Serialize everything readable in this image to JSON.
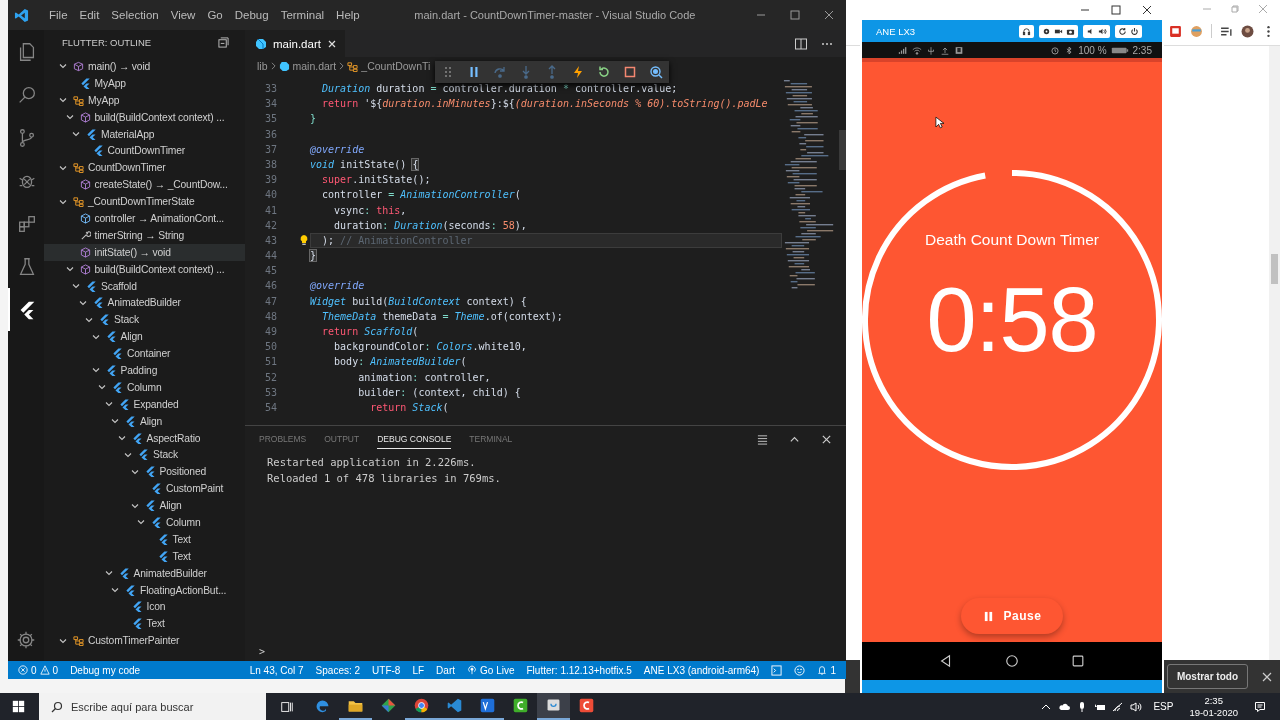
{
  "vscode": {
    "menu": [
      "File",
      "Edit",
      "Selection",
      "View",
      "Go",
      "Debug",
      "Terminal",
      "Help"
    ],
    "title": "main.dart - CountDownTimer-master - Visual Studio Code",
    "activity": [
      {
        "kind": "files",
        "selected": false
      },
      {
        "kind": "search",
        "selected": false
      },
      {
        "kind": "scm",
        "selected": false
      },
      {
        "kind": "debug",
        "selected": false
      },
      {
        "kind": "extensions",
        "selected": false
      },
      {
        "kind": "test",
        "selected": false
      },
      {
        "kind": "flutter",
        "selected": true
      }
    ],
    "sidebar": {
      "title": "FLUTTER: OUTLINE",
      "outline": [
        {
          "label": "main() → void",
          "kind": "function",
          "expanded": true,
          "selected": false,
          "children": [
            {
              "label": "MyApp",
              "kind": "widget",
              "selected": false
            }
          ]
        },
        {
          "label": "MyApp",
          "kind": "class",
          "expanded": true,
          "selected": false,
          "children": [
            {
              "label": "build(BuildContext context) ...",
              "kind": "method",
              "expanded": true,
              "selected": false,
              "children": [
                {
                  "label": "MaterialApp",
                  "kind": "widget",
                  "expanded": true,
                  "selected": false,
                  "children": [
                    {
                      "label": "CountDownTimer",
                      "kind": "widget",
                      "selected": false
                    }
                  ]
                }
              ]
            }
          ]
        },
        {
          "label": "CountDownTimer",
          "kind": "class",
          "expanded": true,
          "selected": false,
          "children": [
            {
              "label": "createState() → _CountDow...",
              "kind": "method",
              "selected": false
            }
          ]
        },
        {
          "label": "_CountDownTimerState",
          "kind": "class",
          "expanded": true,
          "selected": false,
          "children": [
            {
              "label": "controller → AnimationCont...",
              "kind": "field",
              "selected": false
            },
            {
              "label": "timerString → String",
              "kind": "getter",
              "selected": false
            },
            {
              "label": "initState() → void",
              "kind": "method",
              "selected": true
            },
            {
              "label": "build(BuildContext context) ...",
              "kind": "method",
              "expanded": true,
              "selected": false,
              "children": [
                {
                  "label": "Scaffold",
                  "kind": "widget",
                  "expanded": true,
                  "selected": false,
                  "children": [
                    {
                      "label": "AnimatedBuilder",
                      "kind": "widget",
                      "expanded": true,
                      "selected": false,
                      "children": [
                        {
                          "label": "Stack",
                          "kind": "widget",
                          "expanded": true,
                          "selected": false,
                          "children": [
                            {
                              "label": "Align",
                              "kind": "widget",
                              "expanded": true,
                              "selected": false,
                              "children": [
                                {
                                  "label": "Container",
                                  "kind": "widget",
                                  "selected": false
                                }
                              ]
                            },
                            {
                              "label": "Padding",
                              "kind": "widget",
                              "expanded": true,
                              "selected": false,
                              "children": [
                                {
                                  "label": "Column",
                                  "kind": "widget",
                                  "expanded": true,
                                  "selected": false,
                                  "children": [
                                    {
                                      "label": "Expanded",
                                      "kind": "widget",
                                      "expanded": true,
                                      "selected": false,
                                      "children": [
                                        {
                                          "label": "Align",
                                          "kind": "widget",
                                          "expanded": true,
                                          "selected": false,
                                          "children": [
                                            {
                                              "label": "AspectRatio",
                                              "kind": "widget",
                                              "expanded": true,
                                              "selected": false,
                                              "children": [
                                                {
                                                  "label": "Stack",
                                                  "kind": "widget",
                                                  "expanded": true,
                                                  "selected": false,
                                                  "children": [
                                                    {
                                                      "label": "Positioned",
                                                      "kind": "widget",
                                                      "expanded": true,
                                                      "selected": false,
                                                      "children": [
                                                        {
                                                          "label": "CustomPaint",
                                                          "kind": "widget",
                                                          "selected": false
                                                        }
                                                      ]
                                                    },
                                                    {
                                                      "label": "Align",
                                                      "kind": "widget",
                                                      "expanded": true,
                                                      "selected": false,
                                                      "children": [
                                                        {
                                                          "label": "Column",
                                                          "kind": "widget",
                                                          "expanded": true,
                                                          "selected": false,
                                                          "children": [
                                                            {
                                                              "label": "Text",
                                                              "kind": "widget",
                                                              "selected": false
                                                            },
                                                            {
                                                              "label": "Text",
                                                              "kind": "widget",
                                                              "selected": false
                                                            }
                                                          ]
                                                        }
                                                      ]
                                                    }
                                                  ]
                                                }
                                              ]
                                            }
                                          ]
                                        }
                                      ]
                                    },
                                    {
                                      "label": "AnimatedBuilder",
                                      "kind": "widget",
                                      "expanded": true,
                                      "selected": false,
                                      "children": [
                                        {
                                          "label": "FloatingActionBut...",
                                          "kind": "widget",
                                          "expanded": true,
                                          "selected": false,
                                          "children": [
                                            {
                                              "label": "Icon",
                                              "kind": "widget",
                                              "selected": false
                                            },
                                            {
                                              "label": "Text",
                                              "kind": "widget",
                                              "selected": false
                                            }
                                          ]
                                        }
                                      ]
                                    }
                                  ]
                                }
                              ]
                            }
                          ]
                        }
                      ]
                    }
                  ]
                }
              ]
            }
          ]
        },
        {
          "label": "CustomTimerPainter",
          "kind": "class",
          "expanded": true,
          "selected": false
        }
      ]
    },
    "tab": {
      "label": "main.dart"
    },
    "breadcrumb": [
      "lib",
      "main.dart",
      "_CountDownTi"
    ],
    "code": [
      {
        "number": "33",
        "current": false,
        "tokens": [
          {
            "kind": "type",
            "text": "  Duration"
          },
          {
            "kind": "p",
            "text": " duration "
          },
          {
            "kind": "punc",
            "text": "="
          },
          {
            "kind": "p",
            "text": " controller.duration "
          },
          {
            "kind": "punc",
            "text": "*"
          },
          {
            "kind": "p",
            "text": " controller.value;"
          }
        ]
      },
      {
        "number": "34",
        "current": false,
        "tokens": [
          {
            "kind": "kw",
            "text": "  return"
          },
          {
            "kind": "p",
            "text": " '${"
          },
          {
            "kind": "str",
            "text": "duration.inMinutes"
          },
          {
            "kind": "p",
            "text": "}:${"
          },
          {
            "kind": "str",
            "text": "(duration.inSeconds % 60).toString().padLe"
          }
        ]
      },
      {
        "number": "35",
        "current": false,
        "tokens": [
          {
            "kind": "punc",
            "text": "}"
          }
        ]
      },
      {
        "number": "36",
        "current": false
      },
      {
        "number": "37",
        "current": false,
        "tokens": [
          {
            "kind": "deco",
            "text": "@override"
          }
        ]
      },
      {
        "number": "38",
        "current": false,
        "tokens": [
          {
            "kind": "type",
            "text": "void"
          },
          {
            "kind": "p",
            "text": " initState() "
          },
          {
            "kind": "match",
            "text": "{"
          }
        ]
      },
      {
        "number": "39",
        "current": false,
        "tokens": [
          {
            "kind": "kw",
            "text": "  super"
          },
          {
            "kind": "p",
            "text": ".initState();"
          }
        ]
      },
      {
        "number": "40",
        "current": false,
        "tokens": [
          {
            "kind": "p",
            "text": "  controller "
          },
          {
            "kind": "punc",
            "text": "="
          },
          {
            "kind": "type",
            "text": " AnimationController"
          },
          {
            "kind": "p",
            "text": "("
          }
        ]
      },
      {
        "number": "41",
        "current": false,
        "tokens": [
          {
            "kind": "p",
            "text": "    vsync"
          },
          {
            "kind": "punc",
            "text": ":"
          },
          {
            "kind": "kw",
            "text": " this"
          },
          {
            "kind": "p",
            "text": ","
          }
        ]
      },
      {
        "number": "42",
        "current": false,
        "tokens": [
          {
            "kind": "p",
            "text": "    duration"
          },
          {
            "kind": "punc",
            "text": ":"
          },
          {
            "kind": "type",
            "text": " Duration"
          },
          {
            "kind": "p",
            "text": "(seconds"
          },
          {
            "kind": "punc",
            "text": ":"
          },
          {
            "kind": "num",
            "text": " 58"
          },
          {
            "kind": "p",
            "text": "),"
          }
        ]
      },
      {
        "number": "43",
        "current": true,
        "tokens": [
          {
            "kind": "p",
            "text": "  );"
          },
          {
            "kind": "com",
            "text": " // AnimationController"
          }
        ]
      },
      {
        "number": "44",
        "current": false,
        "tokens": [
          {
            "kind": "match",
            "text": "}"
          }
        ]
      },
      {
        "number": "45",
        "current": false
      },
      {
        "number": "46",
        "current": false,
        "tokens": [
          {
            "kind": "deco",
            "text": "@override"
          }
        ]
      },
      {
        "number": "47",
        "current": false,
        "tokens": [
          {
            "kind": "type",
            "text": "Widget"
          },
          {
            "kind": "p",
            "text": " build("
          },
          {
            "kind": "type",
            "text": "BuildContext"
          },
          {
            "kind": "p",
            "text": " context) {"
          }
        ]
      },
      {
        "number": "48",
        "current": false,
        "tokens": [
          {
            "kind": "type",
            "text": "  ThemeData"
          },
          {
            "kind": "p",
            "text": " themeData "
          },
          {
            "kind": "punc",
            "text": "="
          },
          {
            "kind": "type",
            "text": " Theme"
          },
          {
            "kind": "p",
            "text": ".of(context);"
          }
        ]
      },
      {
        "number": "49",
        "current": false,
        "tokens": [
          {
            "kind": "kw",
            "text": "  return"
          },
          {
            "kind": "type",
            "text": " Scaffold"
          },
          {
            "kind": "p",
            "text": "("
          }
        ]
      },
      {
        "number": "50",
        "current": false,
        "tokens": [
          {
            "kind": "p",
            "text": "    backgroundColor"
          },
          {
            "kind": "punc",
            "text": ":"
          },
          {
            "kind": "type",
            "text": " Colors"
          },
          {
            "kind": "p",
            "text": ".white10,"
          }
        ]
      },
      {
        "number": "51",
        "current": false,
        "tokens": [
          {
            "kind": "p",
            "text": "    body"
          },
          {
            "kind": "punc",
            "text": ":"
          },
          {
            "kind": "type",
            "text": " AnimatedBuilder"
          },
          {
            "kind": "p",
            "text": "("
          }
        ]
      },
      {
        "number": "52",
        "current": false,
        "tokens": [
          {
            "kind": "p",
            "text": "        animation"
          },
          {
            "kind": "punc",
            "text": ":"
          },
          {
            "kind": "p",
            "text": " controller,"
          }
        ]
      },
      {
        "number": "53",
        "current": false,
        "tokens": [
          {
            "kind": "p",
            "text": "        builder"
          },
          {
            "kind": "punc",
            "text": ":"
          },
          {
            "kind": "p",
            "text": " (context, child) {"
          }
        ]
      },
      {
        "number": "54",
        "current": false,
        "tokens": [
          {
            "kind": "kw",
            "text": "          return"
          },
          {
            "kind": "type",
            "text": " Stack"
          },
          {
            "kind": "p",
            "text": "("
          }
        ]
      }
    ],
    "panel": {
      "tabs": [
        {
          "label": "PROBLEMS",
          "selected": false
        },
        {
          "label": "OUTPUT",
          "selected": false
        },
        {
          "label": "DEBUG CONSOLE",
          "selected": true
        },
        {
          "label": "TERMINAL",
          "selected": false
        }
      ],
      "lines": [
        "Restarted application in 2.226ms.",
        "Reloaded 1 of 478 libraries in 769ms."
      ],
      "prompt": ">"
    },
    "status": {
      "errors": "0",
      "warnings": "0",
      "left": "Debug my code",
      "right": [
        {
          "text": "Ln 43, Col 7",
          "kind": "text"
        },
        {
          "text": "Spaces: 2",
          "kind": "text"
        },
        {
          "text": "UTF-8",
          "kind": "text"
        },
        {
          "text": "LF",
          "kind": "text"
        },
        {
          "text": "Dart",
          "kind": "text"
        },
        {
          "text": "Go Live",
          "kind": "live"
        },
        {
          "text": "Flutter: 1.12.13+hotfix.5",
          "kind": "text"
        },
        {
          "text": "ANE LX3 (android-arm64)",
          "kind": "text"
        }
      ],
      "notifications": "1"
    }
  },
  "emulator": {
    "device": "ANE LX3",
    "battery": "100 %",
    "clock": "2:35",
    "app": {
      "title": "Death Count Down Timer",
      "time": "0:58",
      "level": 0.97,
      "button": "Pause"
    }
  },
  "browser": {
    "show_all": "Mostrar todo"
  },
  "taskbar": {
    "search": {
      "placeholder": "Escribe aquí para buscar"
    },
    "apps": [
      {
        "kind": "edge",
        "open": false,
        "selected": false
      },
      {
        "kind": "folder",
        "open": true,
        "selected": false
      },
      {
        "kind": "git",
        "open": false,
        "selected": false
      },
      {
        "kind": "chrome",
        "open": true,
        "selected": false
      },
      {
        "kind": "vscode",
        "open": true,
        "selected": false
      },
      {
        "kind": "ve",
        "open": true,
        "selected": false
      },
      {
        "kind": "green",
        "open": false,
        "selected": false
      },
      {
        "kind": "emulator",
        "open": true,
        "selected": true
      },
      {
        "kind": "red",
        "open": false,
        "selected": false
      }
    ],
    "language": "ESP",
    "time": "2:35",
    "date": "19-01-2020"
  }
}
